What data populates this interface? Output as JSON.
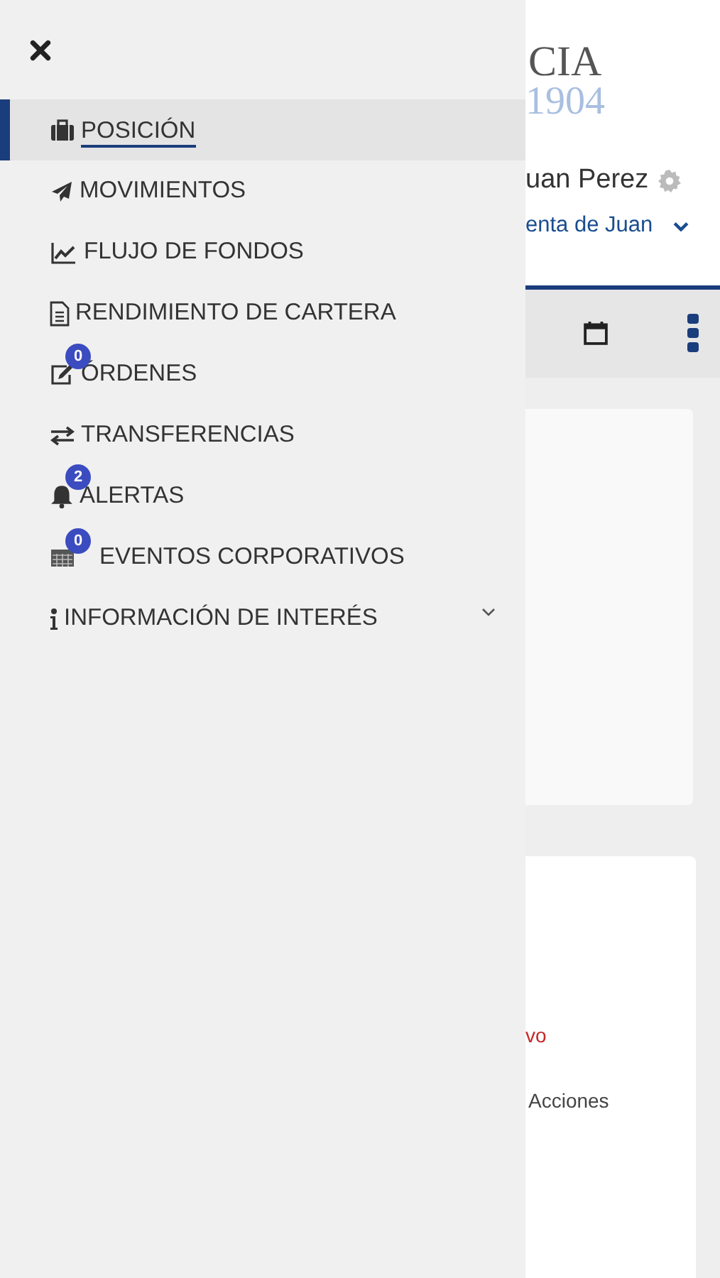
{
  "menu": {
    "items": [
      {
        "label": "POSICIÓN",
        "kind": "briefcase",
        "selected": true
      },
      {
        "label": "MOVIMIENTOS",
        "kind": "plane",
        "selected": false
      },
      {
        "label": "FLUJO DE FONDOS",
        "kind": "chart",
        "selected": false
      },
      {
        "label": "RENDIMIENTO DE CARTERA",
        "kind": "document",
        "selected": false
      },
      {
        "label": "ÓRDENES",
        "kind": "edit",
        "badge": "0",
        "selected": false
      },
      {
        "label": "TRANSFERENCIAS",
        "kind": "arrows",
        "selected": false
      },
      {
        "label": "ALERTAS",
        "kind": "bell",
        "badge": "2",
        "selected": false
      },
      {
        "label": "EVENTOS CORPORATIVOS",
        "kind": "calendar",
        "badge": "0",
        "selected": false
      },
      {
        "label": "INFORMACIÓN DE INTERÉS",
        "kind": "info",
        "expanded": false,
        "selected": false
      }
    ]
  },
  "header": {
    "logo": {
      "name": "CIA",
      "year": "1904"
    },
    "user": "uan Perez",
    "account": "enta de Juan"
  },
  "cards": [
    {
      "kind": "summary"
    },
    {
      "kind": "detail",
      "texts": [
        {
          "kind": "warning",
          "text": "vo"
        },
        {
          "kind": "label",
          "text": "Acciones"
        }
      ]
    }
  ]
}
